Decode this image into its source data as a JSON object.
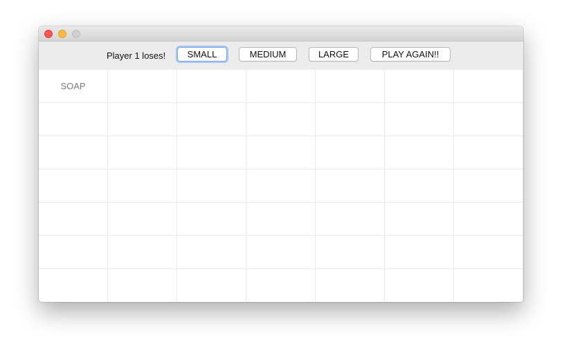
{
  "window": {
    "controls": {
      "close_icon": "close-circle-icon",
      "minimize_icon": "minimize-circle-icon",
      "zoom_icon": "zoom-circle-icon",
      "close_color": "#fc5753",
      "minimize_color": "#fdbc40",
      "zoom_color": "#d0d0d0"
    }
  },
  "toolbar": {
    "status": "Player 1 loses!",
    "buttons": {
      "small": "SMALL",
      "medium": "MEDIUM",
      "large": "LARGE",
      "play_again": "PLAY AGAIN!!"
    },
    "focused_button": "small"
  },
  "grid": {
    "rows": [
      [
        "SOAP",
        "",
        "",
        "",
        "",
        "",
        ""
      ],
      [
        "",
        "",
        "",
        "",
        "",
        "",
        ""
      ],
      [
        "",
        "",
        "",
        "",
        "",
        "",
        ""
      ],
      [
        "",
        "",
        "",
        "",
        "",
        "",
        ""
      ],
      [
        "",
        "",
        "",
        "",
        "",
        "",
        ""
      ],
      [
        "",
        "",
        "",
        "",
        "",
        "",
        ""
      ],
      [
        "",
        "",
        "",
        "",
        "",
        "",
        ""
      ]
    ]
  }
}
